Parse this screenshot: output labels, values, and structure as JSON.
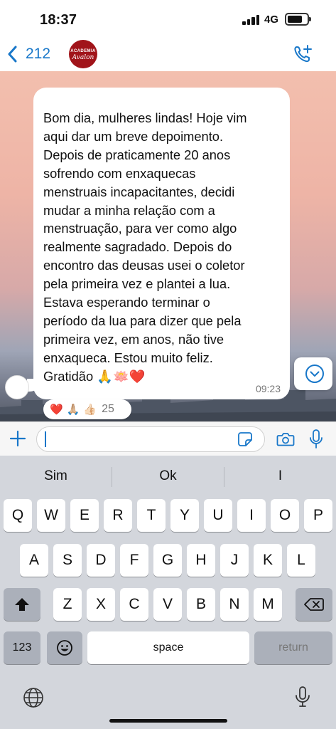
{
  "status_bar": {
    "time": "18:37",
    "network": "4G",
    "battery_level": 0.75
  },
  "header": {
    "back_count": "212",
    "avatar_line1": "ACADEMIA",
    "avatar_line2": "Avalon"
  },
  "message": {
    "text": "Bom dia, mulheres lindas! Hoje vim\naqui dar um breve depoimento.\nDepois de praticamente 20 anos\nsofrendo com enxaquecas\nmenstruais incapacitantes, decidi\nmudar a minha relação com a\nmenstruação, para ver como algo\nrealmente sagradado. Depois do\nencontro das deusas usei o coletor\npela primeira vez e plantei a lua.\nEstava esperando terminar o\nperíodo da lua para dizer que pela\nprimeira vez, em anos, não tive\nenxaqueca. Estou muito feliz.\nGratidão 🙏🪷❤️",
    "time": "09:23",
    "reactions": [
      "❤️",
      "🙏🏼",
      "👍🏻"
    ],
    "reaction_count": "25"
  },
  "input": {
    "value": ""
  },
  "keyboard": {
    "suggestions": [
      "Sim",
      "Ok",
      "I"
    ],
    "row1": [
      "Q",
      "W",
      "E",
      "R",
      "T",
      "Y",
      "U",
      "I",
      "O",
      "P"
    ],
    "row2": [
      "A",
      "S",
      "D",
      "F",
      "G",
      "H",
      "J",
      "K",
      "L"
    ],
    "row3": [
      "Z",
      "X",
      "C",
      "V",
      "B",
      "N",
      "M"
    ],
    "numbers_label": "123",
    "space_label": "space",
    "return_label": "return"
  }
}
